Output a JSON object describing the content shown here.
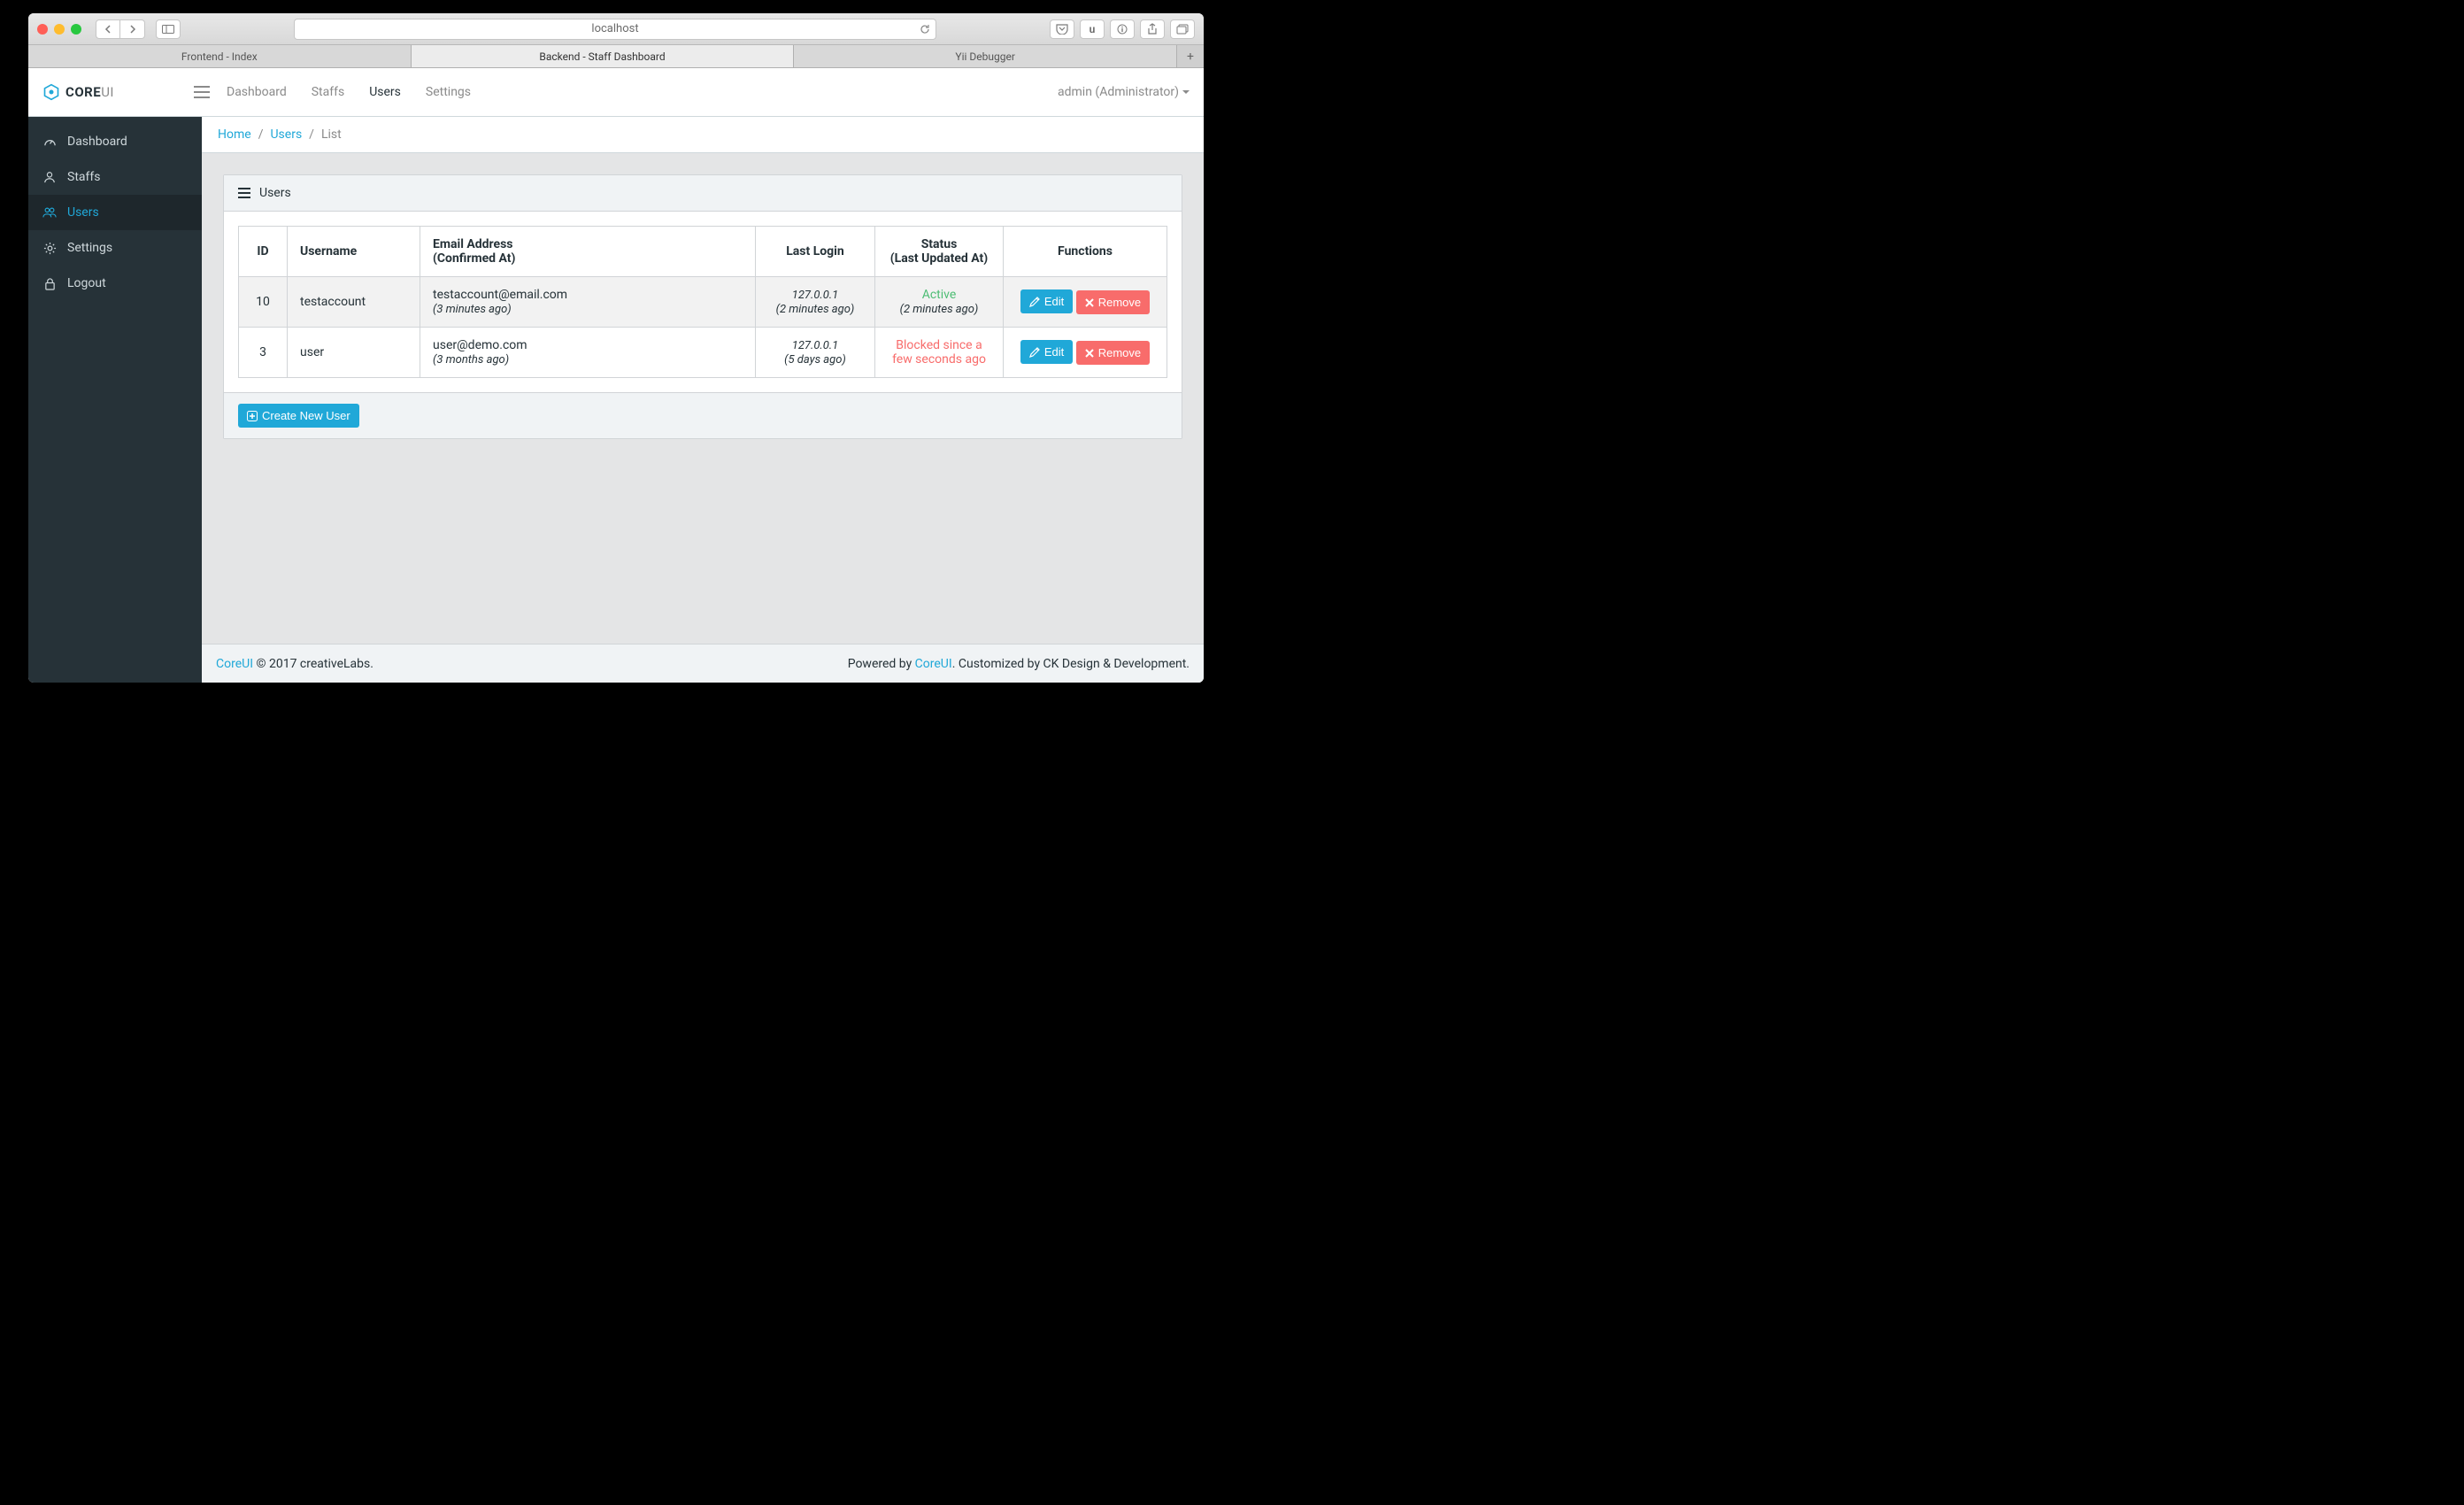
{
  "browser": {
    "address": "localhost",
    "tabs": [
      "Frontend - Index",
      "Backend - Staff Dashboard",
      "Yii Debugger"
    ],
    "active_tab": 1,
    "toolbar_button_u": "u"
  },
  "brand": {
    "name_core": "CORE",
    "name_ui": "UI"
  },
  "top_nav": {
    "items": [
      "Dashboard",
      "Staffs",
      "Users",
      "Settings"
    ],
    "active": 2
  },
  "user_menu": {
    "label": "admin (Administrator)"
  },
  "sidebar": {
    "items": [
      {
        "label": "Dashboard",
        "icon": "speedometer"
      },
      {
        "label": "Staffs",
        "icon": "user"
      },
      {
        "label": "Users",
        "icon": "users"
      },
      {
        "label": "Settings",
        "icon": "gear"
      },
      {
        "label": "Logout",
        "icon": "lock"
      }
    ],
    "active": 2
  },
  "breadcrumb": {
    "home": "Home",
    "users": "Users",
    "current": "List",
    "sep": "/"
  },
  "panel": {
    "title": "Users"
  },
  "table": {
    "headers": {
      "id": "ID",
      "username": "Username",
      "email_line1": "Email Address",
      "email_line2": "(Confirmed At)",
      "last_login": "Last Login",
      "status_line1": "Status",
      "status_line2": "(Last Updated At)",
      "functions": "Functions"
    },
    "rows": [
      {
        "id": "10",
        "username": "testaccount",
        "email": "testaccount@email.com",
        "email_sub": "(3 minutes ago)",
        "login_ip": "127.0.0.1",
        "login_sub": "(2 minutes ago)",
        "status": "Active",
        "status_class": "active",
        "status_sub": "(2 minutes ago)"
      },
      {
        "id": "3",
        "username": "user",
        "email": "user@demo.com",
        "email_sub": "(3 months ago)",
        "login_ip": "127.0.0.1",
        "login_sub": "(5 days ago)",
        "status": "Blocked since a few seconds ago",
        "status_class": "blocked",
        "status_sub": ""
      }
    ],
    "buttons": {
      "edit": "Edit",
      "remove": "Remove"
    }
  },
  "create_button": "Create New User",
  "footer": {
    "brand_link": "CoreUI",
    "copyright": " © 2017 creativeLabs.",
    "powered_prefix": "Powered by ",
    "powered_link": "CoreUI",
    "powered_suffix": ". Customized by CK Design & Development."
  }
}
